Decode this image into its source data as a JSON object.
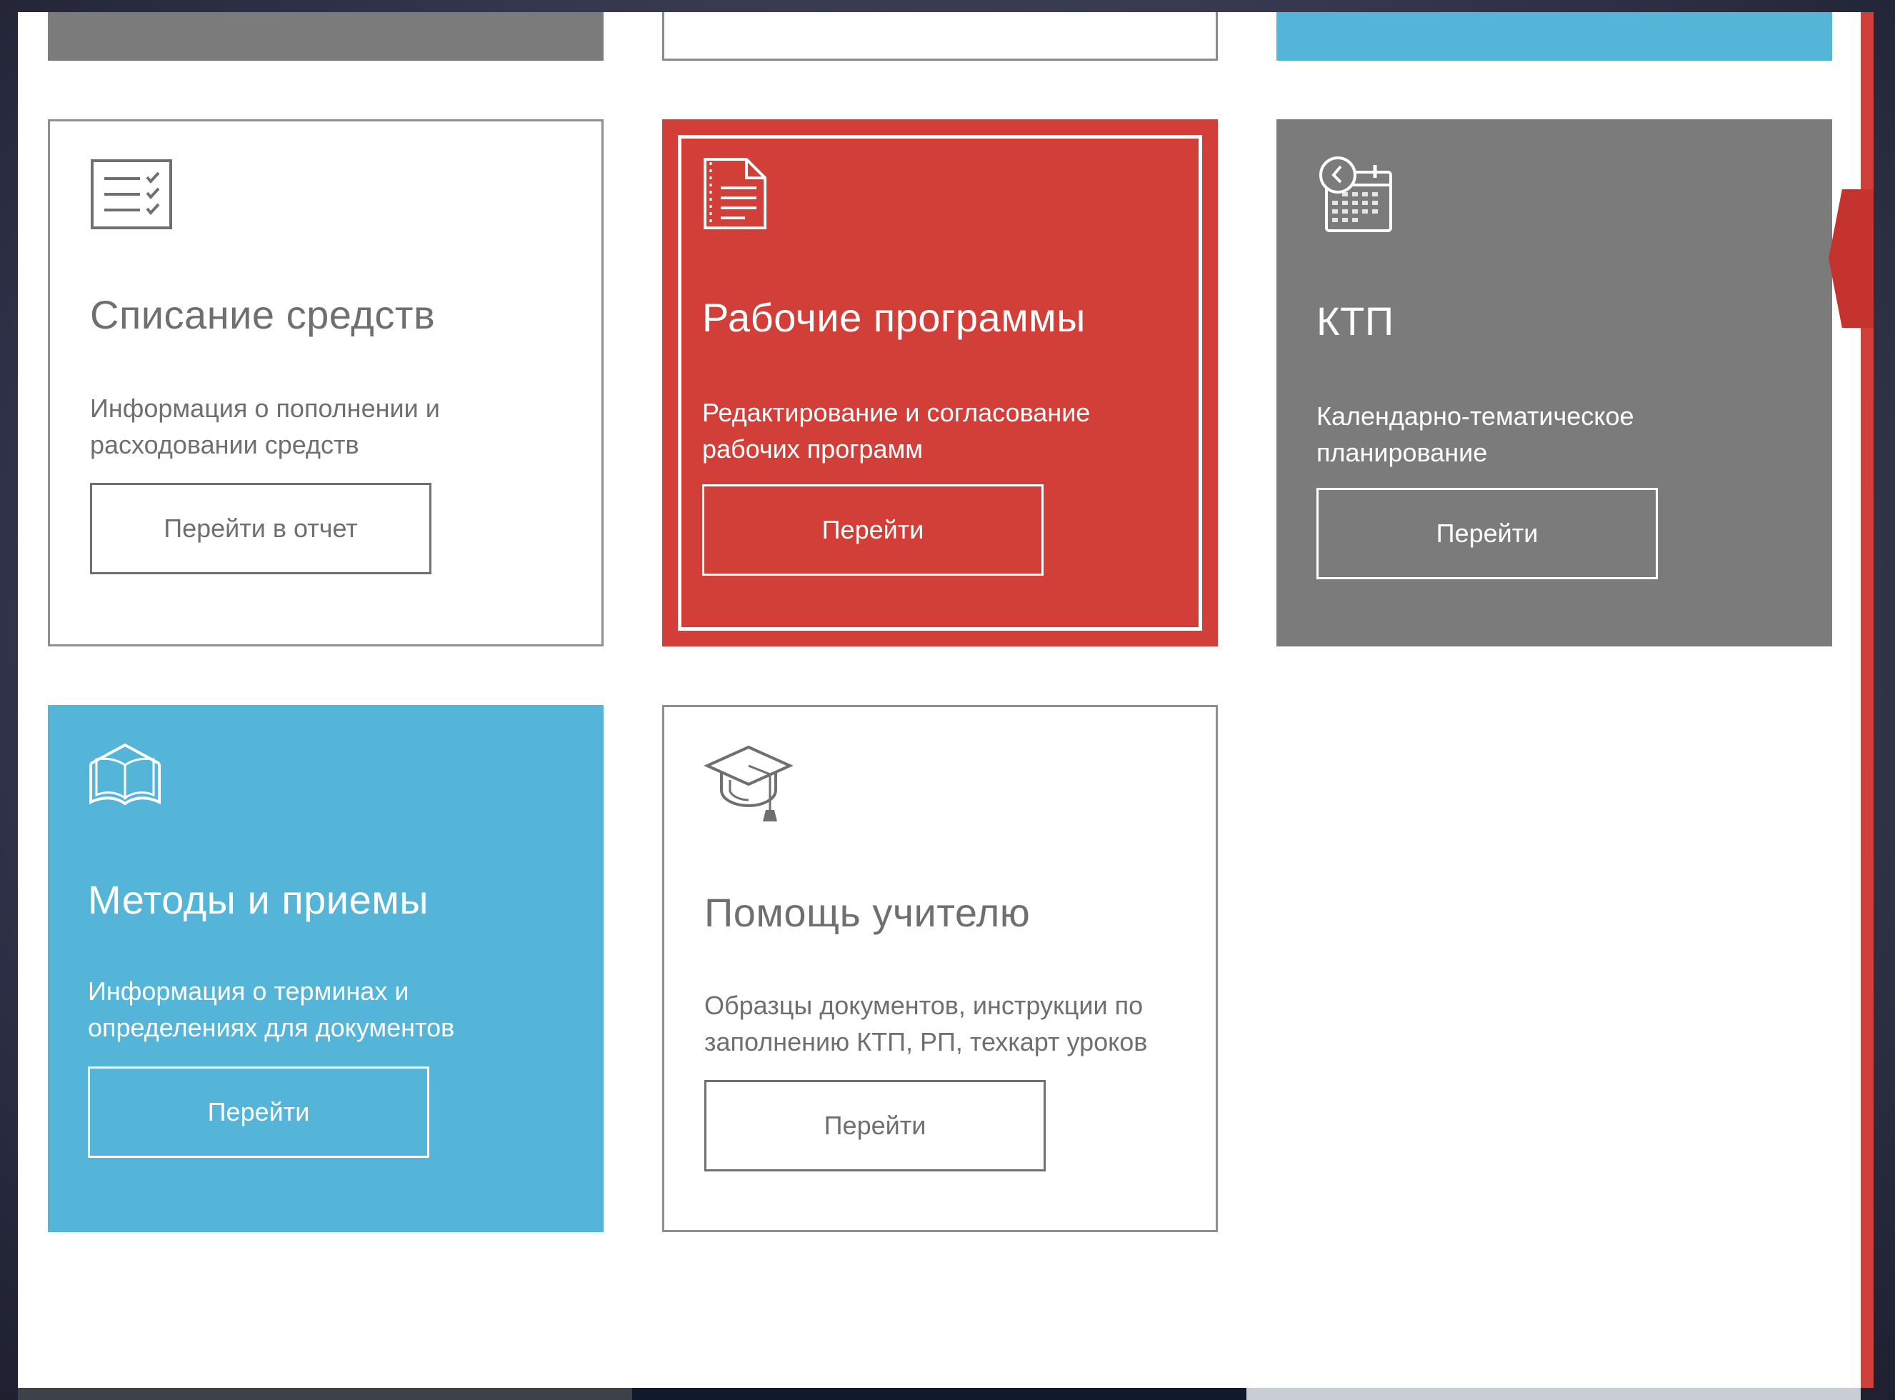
{
  "colors": {
    "red": "#d23f38",
    "gray": "#7b7b7b",
    "blue": "#55b5d8",
    "text_gray": "#6f6f6f"
  },
  "cards": [
    {
      "icon": "checklist-icon",
      "title": "Списание средств",
      "description": "Информация о пополнении и расходовании средств",
      "button": "Перейти в отчет"
    },
    {
      "icon": "document-icon",
      "title": "Рабочие программы",
      "description": "Редактирование и согласование рабочих программ",
      "button": "Перейти"
    },
    {
      "icon": "calendar-clock-icon",
      "title": "КТП",
      "description": "Календарно-тематическое планирование",
      "button": "Перейти"
    },
    {
      "icon": "open-book-icon",
      "title": "Методы и приемы",
      "description": "Информация о терминах и определениях для документов",
      "button": "Перейти"
    },
    {
      "icon": "graduation-cap-icon",
      "title": "Помощь учителю",
      "description": "Образцы документов, инструкции по заполнению КТП, РП, техкарт уроков",
      "button": "Перейти"
    }
  ]
}
